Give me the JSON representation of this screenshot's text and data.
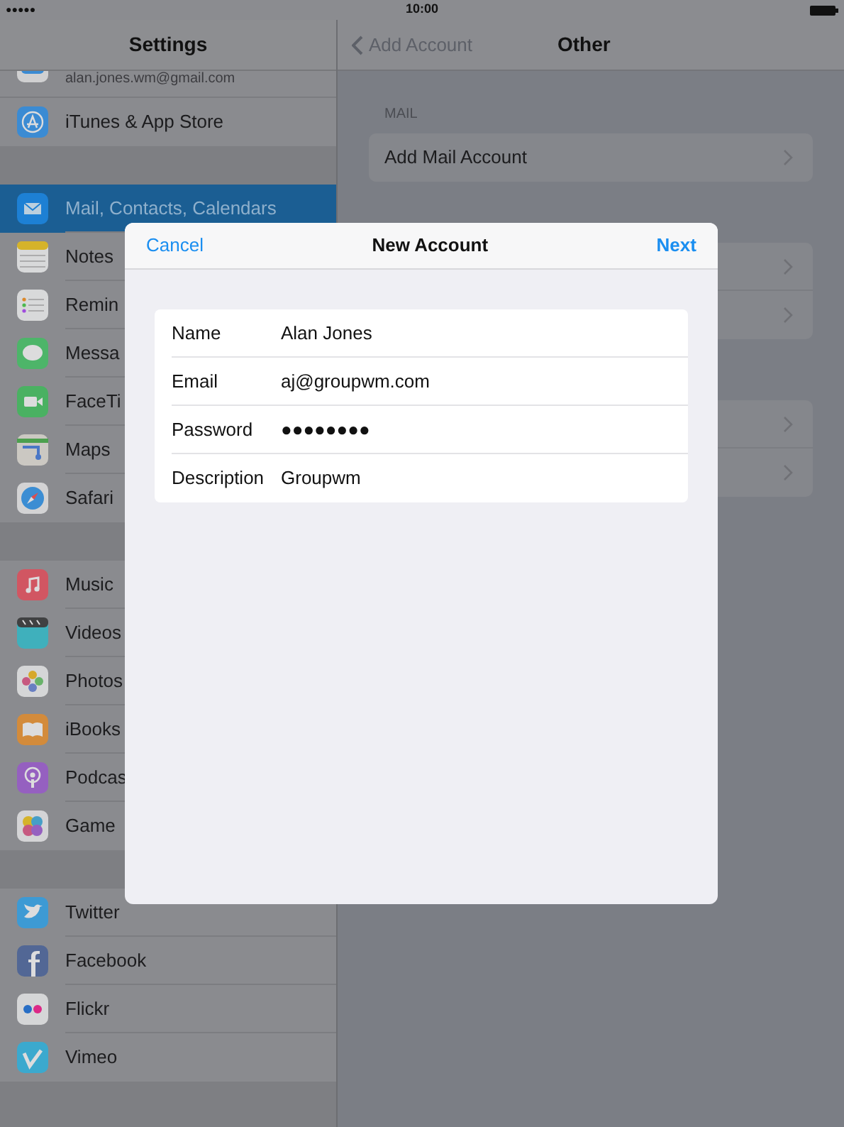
{
  "status_bar": {
    "signal": "●●●●●",
    "time": "10:00"
  },
  "sidebar": {
    "title": "Settings",
    "groups": [
      {
        "items": [
          {
            "label": "alan.jones.wm@gmail.com",
            "kind": "subtitle",
            "selected": false
          },
          {
            "label": "iTunes & App Store",
            "kind": "row",
            "selected": false
          }
        ]
      },
      {
        "items": [
          {
            "label": "Mail, Contacts, Calendars",
            "kind": "row",
            "selected": true
          },
          {
            "label": "Notes",
            "kind": "row",
            "selected": false
          },
          {
            "label": "Remin",
            "kind": "row",
            "selected": false
          },
          {
            "label": "Messa",
            "kind": "row",
            "selected": false
          },
          {
            "label": "FaceTi",
            "kind": "row",
            "selected": false
          },
          {
            "label": "Maps",
            "kind": "row",
            "selected": false
          },
          {
            "label": "Safari",
            "kind": "row",
            "selected": false
          }
        ]
      },
      {
        "items": [
          {
            "label": "Music",
            "kind": "row",
            "selected": false
          },
          {
            "label": "Videos",
            "kind": "row",
            "selected": false
          },
          {
            "label": "Photos",
            "kind": "row",
            "selected": false
          },
          {
            "label": "iBooks",
            "kind": "row",
            "selected": false
          },
          {
            "label": "Podcas",
            "kind": "row",
            "selected": false
          },
          {
            "label": "Game",
            "kind": "row",
            "selected": false
          }
        ]
      },
      {
        "items": [
          {
            "label": "Twitter",
            "kind": "row",
            "selected": false
          },
          {
            "label": "Facebook",
            "kind": "row",
            "selected": false
          },
          {
            "label": "Flickr",
            "kind": "row",
            "selected": false
          },
          {
            "label": "Vimeo",
            "kind": "row",
            "selected": false
          }
        ]
      }
    ]
  },
  "detail": {
    "back": "Add Account",
    "title": "Other",
    "sections": [
      {
        "header": "MAIL",
        "rows": [
          {
            "label": "Add Mail Account"
          }
        ]
      },
      {
        "rows": [
          {},
          {}
        ]
      },
      {
        "rows": [
          {},
          {}
        ]
      }
    ]
  },
  "dialog": {
    "cancel": "Cancel",
    "title": "New Account",
    "next": "Next",
    "fields": [
      {
        "label": "Name",
        "value": "Alan Jones"
      },
      {
        "label": "Email",
        "value": "aj@groupwm.com"
      },
      {
        "label": "Password",
        "value": "●●●●●●●●"
      },
      {
        "label": "Description",
        "value": "Groupwm"
      }
    ]
  }
}
